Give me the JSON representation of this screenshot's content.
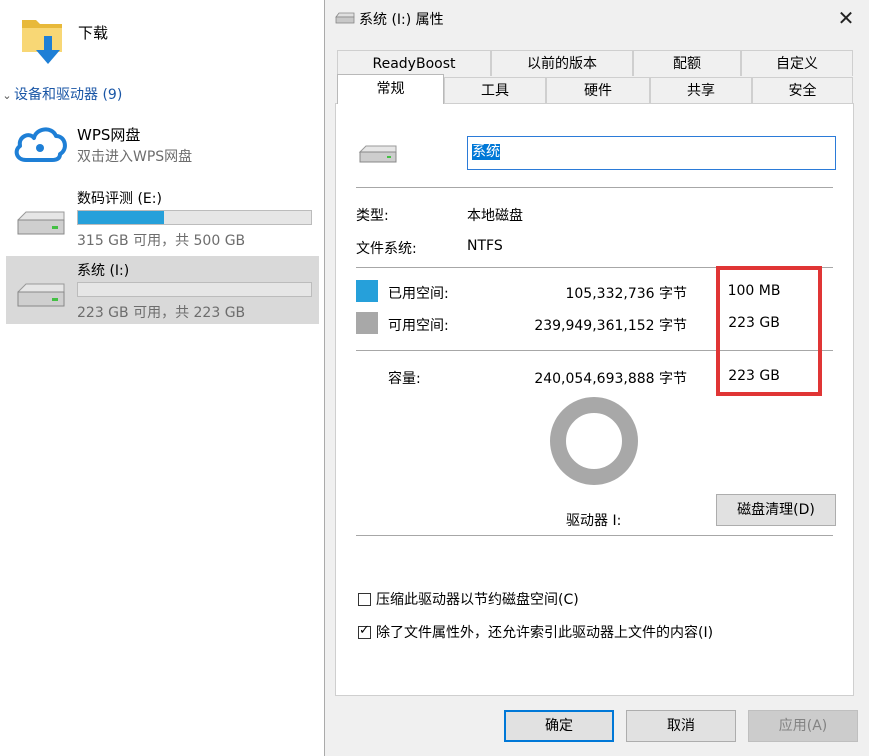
{
  "explorer": {
    "downloads_label": "下载",
    "group_header": "设备和驱动器 (9)",
    "wps": {
      "title": "WPS网盘",
      "subtitle": "双击进入WPS网盘"
    },
    "drives": [
      {
        "name": "数码评测 (E:)",
        "space": "315 GB 可用，共 500 GB",
        "used_fraction": 0.37
      },
      {
        "name": "系统 (I:)",
        "space": "223 GB 可用，共 223 GB",
        "used_fraction": 0.0
      }
    ]
  },
  "dialog": {
    "title": "系统 (I:) 属性",
    "close_glyph": "✕",
    "tabs_back": [
      "ReadyBoost",
      "以前的版本",
      "配额",
      "自定义"
    ],
    "tabs_front": [
      "常规",
      "工具",
      "硬件",
      "共享",
      "安全"
    ],
    "active_tab": "常规",
    "name_value": "系统",
    "type_label": "类型:",
    "type_value": "本地磁盘",
    "fs_label": "文件系统:",
    "fs_value": "NTFS",
    "used": {
      "label": "已用空间:",
      "bytes": "105,332,736 字节",
      "human": "100 MB",
      "color": "#26a0da"
    },
    "free": {
      "label": "可用空间:",
      "bytes": "239,949,361,152 字节",
      "human": "223 GB",
      "color": "#a8a8a8"
    },
    "capacity": {
      "label": "容量:",
      "bytes": "240,054,693,888 字节",
      "human": "223 GB"
    },
    "drive_label": "驱动器 I:",
    "cleanup_button": "磁盘清理(D)",
    "compress": {
      "label": "压缩此驱动器以节约磁盘空间(C)",
      "checked": false
    },
    "index": {
      "label": "除了文件属性外，还允许索引此驱动器上文件的内容(I)",
      "checked": true
    },
    "buttons": {
      "ok": "确定",
      "cancel": "取消",
      "apply": "应用(A)"
    },
    "highlight_color": "#e03535"
  }
}
